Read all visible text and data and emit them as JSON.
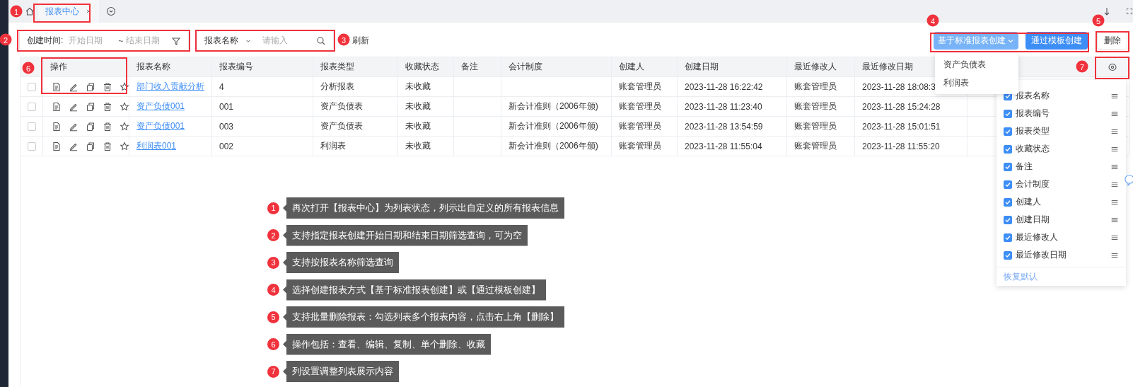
{
  "tab_bar": {
    "tabs": [
      {
        "label": "报表中心",
        "selected": true
      }
    ]
  },
  "filters": {
    "date_label": "创建时间:",
    "start_placeholder": "开始日期",
    "separator": "~",
    "end_placeholder": "结束日期",
    "name_select": "报表名称",
    "name_placeholder": "请输入",
    "refresh": "刷新"
  },
  "actions": {
    "create_standard": "基于标准报表创建",
    "create_template": "通过模板创建",
    "delete": "删除"
  },
  "create_menu": {
    "items": [
      "资产负债表",
      "利润表"
    ]
  },
  "table": {
    "actions_header": "操作",
    "columns": [
      "报表名称",
      "报表编号",
      "报表类型",
      "收藏状态",
      "备注",
      "会计制度",
      "创建人",
      "创建日期",
      "最近修改人",
      "最近修改日期"
    ],
    "rows": [
      {
        "checked": false,
        "cells": [
          "部门收入贡献分析",
          "4",
          "分析报表",
          "未收藏",
          null,
          null,
          "账套管理员",
          "2023-11-28 16:22:42",
          "账套管理员",
          "2023-11-28 18:08:3"
        ]
      },
      {
        "checked": false,
        "cells": [
          "资产负债001",
          "001",
          "资产负债表",
          "未收藏",
          null,
          "新会计准则（2006年颁)",
          "账套管理员",
          "2023-11-28 11:23:40",
          "账套管理员",
          "2023-11-28 15:24:28"
        ]
      },
      {
        "checked": false,
        "cells": [
          "资产负债001",
          "003",
          "资产负债表",
          "未收藏",
          null,
          "新会计准则（2006年颁)",
          "账套管理员",
          "2023-11-28 13:54:59",
          "账套管理员",
          "2023-11-28 15:01:51"
        ]
      },
      {
        "checked": false,
        "cells": [
          "利润表001",
          "002",
          "利润表",
          "未收藏",
          null,
          "新会计准则（2006年颁)",
          "账套管理员",
          "2023-11-28 11:55:04",
          "账套管理员",
          "2023-11-28 11:55:20"
        ]
      }
    ]
  },
  "column_settings": {
    "items": [
      {
        "label": "报表名称",
        "checked": true
      },
      {
        "label": "报表编号",
        "checked": true
      },
      {
        "label": "报表类型",
        "checked": true
      },
      {
        "label": "收藏状态",
        "checked": true
      },
      {
        "label": "备注",
        "checked": true
      },
      {
        "label": "会计制度",
        "checked": true
      },
      {
        "label": "创建人",
        "checked": true
      },
      {
        "label": "创建日期",
        "checked": true
      },
      {
        "label": "最近修改人",
        "checked": true
      },
      {
        "label": "最近修改日期",
        "checked": true
      }
    ],
    "reset": "恢复默认"
  },
  "markers": [
    "1",
    "2",
    "3",
    "4",
    "5",
    "6",
    "7"
  ],
  "callouts": [
    {
      "number": "1",
      "text": "再次打开【报表中心】为列表状态，列示出自定义的所有报表信息"
    },
    {
      "number": "2",
      "text": "支持指定报表创建开始日期和结束日期筛选查询，可为空"
    },
    {
      "number": "3",
      "text": "支持按报表名称筛选查询"
    },
    {
      "number": "4",
      "text": "选择创建报表方式【基于标准报表创建】或【通过模板创建】"
    },
    {
      "number": "5",
      "text": "支持批量删除报表：勾选列表多个报表内容，点击右上角【删除】"
    },
    {
      "number": "6",
      "text": "操作包括：查看、编辑、复制、单个删除、收藏"
    },
    {
      "number": "7",
      "text": "列设置调整列表展示内容"
    }
  ]
}
